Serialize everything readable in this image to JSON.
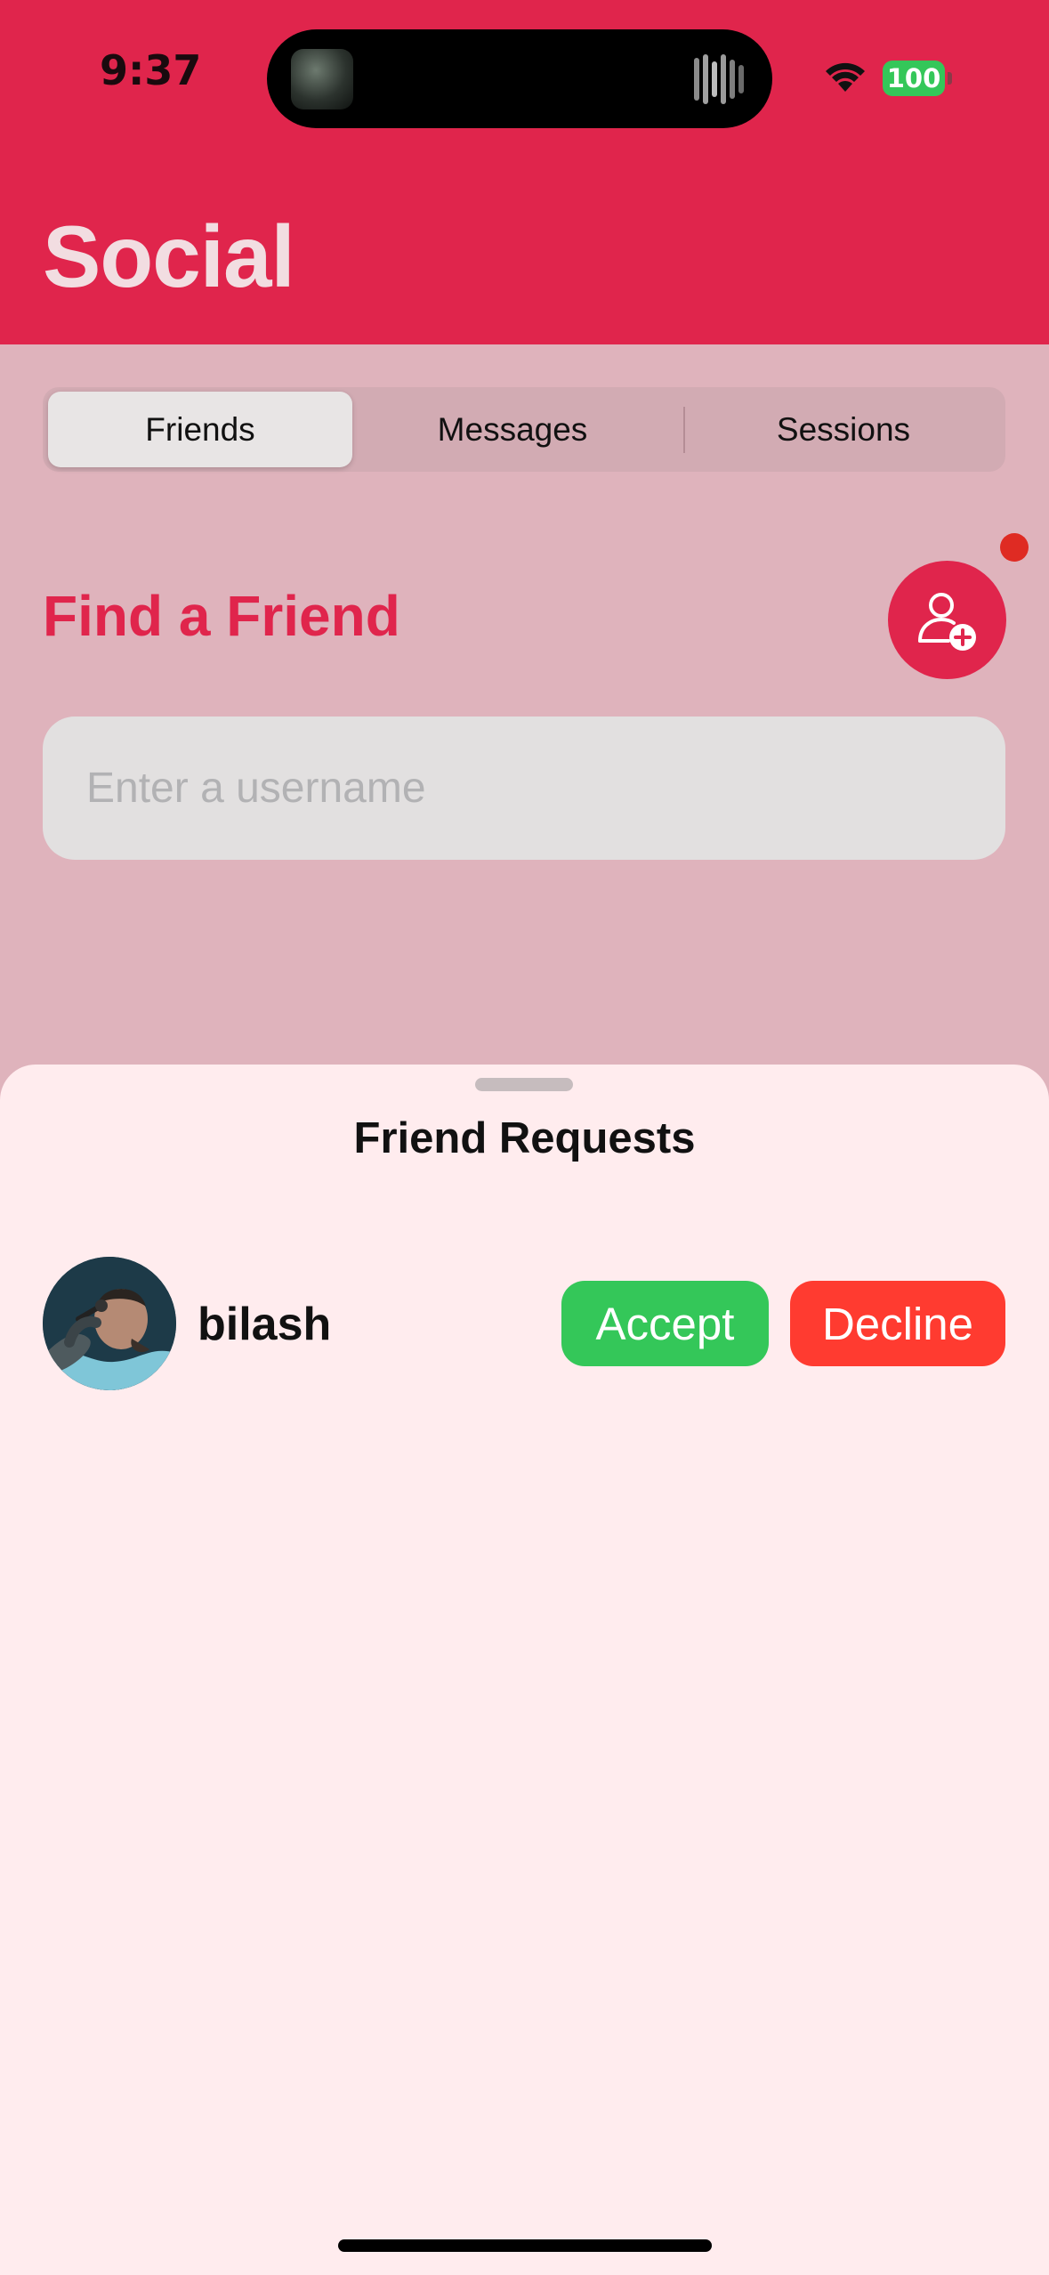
{
  "status_bar": {
    "time": "9:37",
    "battery": "100"
  },
  "header": {
    "title": "Social"
  },
  "tabs": [
    {
      "label": "Friends",
      "selected": true
    },
    {
      "label": "Messages",
      "selected": false
    },
    {
      "label": "Sessions",
      "selected": false
    }
  ],
  "find_friend": {
    "title": "Find a Friend",
    "input_placeholder": "Enter a username",
    "input_value": "",
    "add_button_icon": "person-add-icon"
  },
  "requests_sheet": {
    "title": "Friend Requests",
    "requests": [
      {
        "username": "bilash",
        "accept_label": "Accept",
        "decline_label": "Decline"
      }
    ]
  },
  "colors": {
    "accent": "#e0254c",
    "accept": "#34c759",
    "decline": "#ff3b30",
    "sheet_background": "#ffecee"
  }
}
